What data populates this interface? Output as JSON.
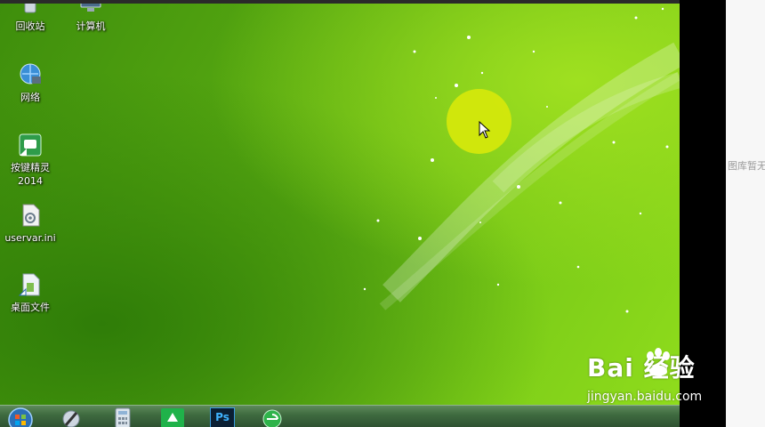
{
  "desktop": {
    "icons": [
      {
        "label": "回收站",
        "icon": "recycle-bin-icon"
      },
      {
        "label": "计算机",
        "icon": "computer-icon"
      },
      {
        "label": "网络",
        "icon": "network-icon"
      },
      {
        "label": "按键精灵",
        "label2": "2014",
        "icon": "anjian-jingling-icon"
      },
      {
        "label": "uservar.ini",
        "icon": "ini-file-icon"
      },
      {
        "label": "桌面文件",
        "icon": "folder-shortcut-icon"
      }
    ]
  },
  "taskbar": {
    "items": [
      {
        "icon": "start-orb-icon"
      },
      {
        "icon": "media-player-icon"
      },
      {
        "icon": "calculator-icon"
      },
      {
        "icon": "green-app-icon"
      },
      {
        "icon": "photoshop-icon",
        "text": "Ps"
      },
      {
        "icon": "browser-icon"
      }
    ]
  },
  "side_panel": {
    "text": "图库暂无"
  },
  "watermark": {
    "brand": "Bai 经验",
    "url": "jingyan.baidu.com"
  },
  "colors": {
    "highlight": "#d4e80c",
    "wallpaper_green": "#5cae12"
  }
}
